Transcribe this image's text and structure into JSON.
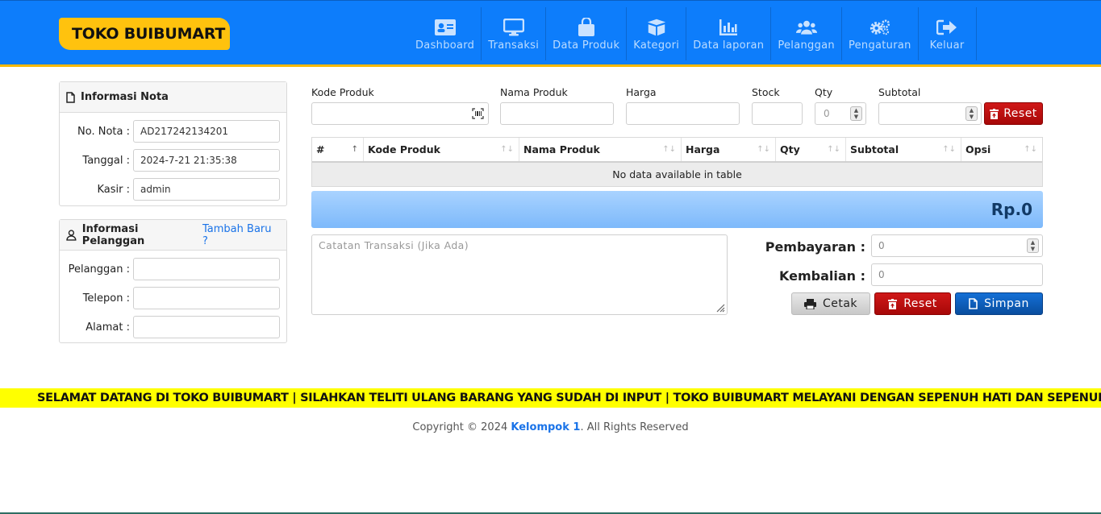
{
  "brand": "TOKO BUIBUMART",
  "nav": [
    {
      "label": "Dashboard",
      "icon": "id-card-icon"
    },
    {
      "label": "Transaksi",
      "icon": "monitor-icon"
    },
    {
      "label": "Data Produk",
      "icon": "shopping-bag-icon"
    },
    {
      "label": "Kategori",
      "icon": "boxes-icon"
    },
    {
      "label": "Data laporan",
      "icon": "bar-chart-icon"
    },
    {
      "label": "Pelanggan",
      "icon": "users-icon"
    },
    {
      "label": "Pengaturan",
      "icon": "gears-icon"
    },
    {
      "label": "Keluar",
      "icon": "sign-out-icon"
    }
  ],
  "nota": {
    "title": "Informasi Nota",
    "no_label": "No. Nota :",
    "no_value": "AD217242134201",
    "tanggal_label": "Tanggal :",
    "tanggal_value": "2024-7-21 21:35:38",
    "kasir_label": "Kasir :",
    "kasir_value": "admin"
  },
  "pelanggan": {
    "title": "Informasi Pelanggan",
    "add_link": "Tambah Baru ?",
    "pelanggan_label": "Pelanggan :",
    "telepon_label": "Telepon :",
    "alamat_label": "Alamat :"
  },
  "entry": {
    "kode_label": "Kode Produk",
    "nama_label": "Nama Produk",
    "harga_label": "Harga",
    "stock_label": "Stock",
    "qty_label": "Qty",
    "qty_value": "0",
    "subtotal_label": "Subtotal",
    "reset_label": "Reset"
  },
  "table": {
    "columns": [
      "#",
      "Kode Produk",
      "Nama Produk",
      "Harga",
      "Qty",
      "Subtotal",
      "Opsi"
    ],
    "empty_text": "No data available in table"
  },
  "total": "Rp.0",
  "notes_placeholder": "Catatan Transaksi (Jika Ada)",
  "payment": {
    "pembayaran_label": "Pembayaran :",
    "pembayaran_value": "0",
    "kembalian_label": "Kembalian :",
    "kembalian_value": "0",
    "cetak_label": "Cetak",
    "reset_label": "Reset",
    "simpan_label": "Simpan"
  },
  "marquee": "SELAMAT DATANG DI TOKO BUIBUMART | SILAHKAN TELITI ULANG BARANG YANG SUDAH DI INPUT | TOKO BUIBUMART MELAYANI DENGAN SEPENUH HATI DAN SEPENUH J",
  "footer": {
    "prefix": "Copyright © 2024 ",
    "team": "Kelompok 1",
    "suffix": ". All Rights Reserved"
  },
  "colors": {
    "header": "#0d7dfb",
    "brand_bg": "#ffc20e",
    "marquee_bg": "#ffff00",
    "danger": "#b80f0f",
    "primary": "#0a5cb8"
  }
}
